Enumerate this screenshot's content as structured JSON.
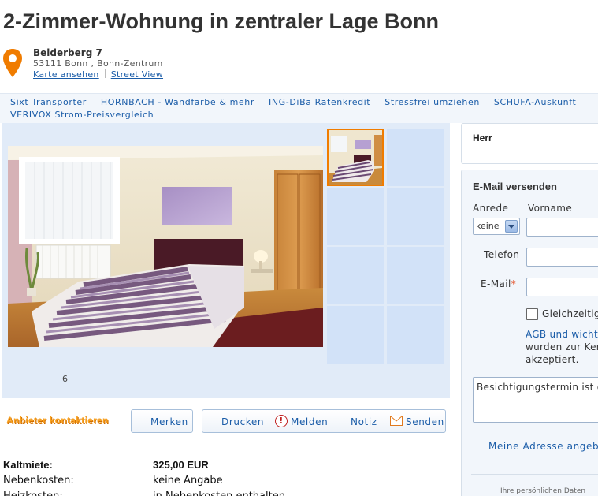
{
  "listing": {
    "title": "2-Zimmer-Wohnung in zentraler Lage Bonn",
    "street": "Belderberg 7",
    "city": "53111 Bonn , Bonn-Zentrum",
    "map_link": "Karte ansehen",
    "street_view_link": "Street View"
  },
  "ad_links": {
    "row1": [
      "Sixt Transporter",
      "HORNBACH - Wandfarbe & mehr",
      "ING-DiBa Ratenkredit",
      "Stressfrei umziehen",
      "SCHUFA-Auskunft"
    ],
    "row2": [
      "VERIVOX Strom-Preisvergleich"
    ]
  },
  "gallery": {
    "photo_count": "6"
  },
  "actions": {
    "contact": "Anbieter kontaktieren",
    "merken": "Merken",
    "drucken": "Drucken",
    "melden": "Melden",
    "melden_icon": "!",
    "notiz": "Notiz",
    "senden": "Senden"
  },
  "facts": [
    {
      "label": "Kaltmiete:",
      "value": "325,00 EUR",
      "bold": true
    },
    {
      "label": "Nebenkosten:",
      "value": "keine Angabe",
      "bold": false
    },
    {
      "label": "Heizkosten:",
      "value": "in Nebenkosten enthalten",
      "bold": false
    }
  ],
  "contact_person": {
    "salutation": "Herr"
  },
  "email_form": {
    "title": "E-Mail versenden",
    "anrede_label": "Anrede",
    "vorname_label": "Vorname",
    "anrede_value": "keine",
    "telefon_label": "Telefon",
    "email_label": "E-Mail",
    "required_mark": "*",
    "checkbox_label": "Gleichzeitig",
    "agb_line1_link": "AGB und wicht",
    "agb_line2": "wurden zur Ken",
    "agb_line3": "akzeptiert.",
    "message": "Besichtigungstermin ist e",
    "address_link": "Meine Adresse angeben",
    "privacy_note": "Ihre persönlichen Daten"
  },
  "colors": {
    "accent_orange": "#f07c00",
    "link_blue": "#1a5ca8",
    "gallery_bg": "#e1ebf8"
  }
}
